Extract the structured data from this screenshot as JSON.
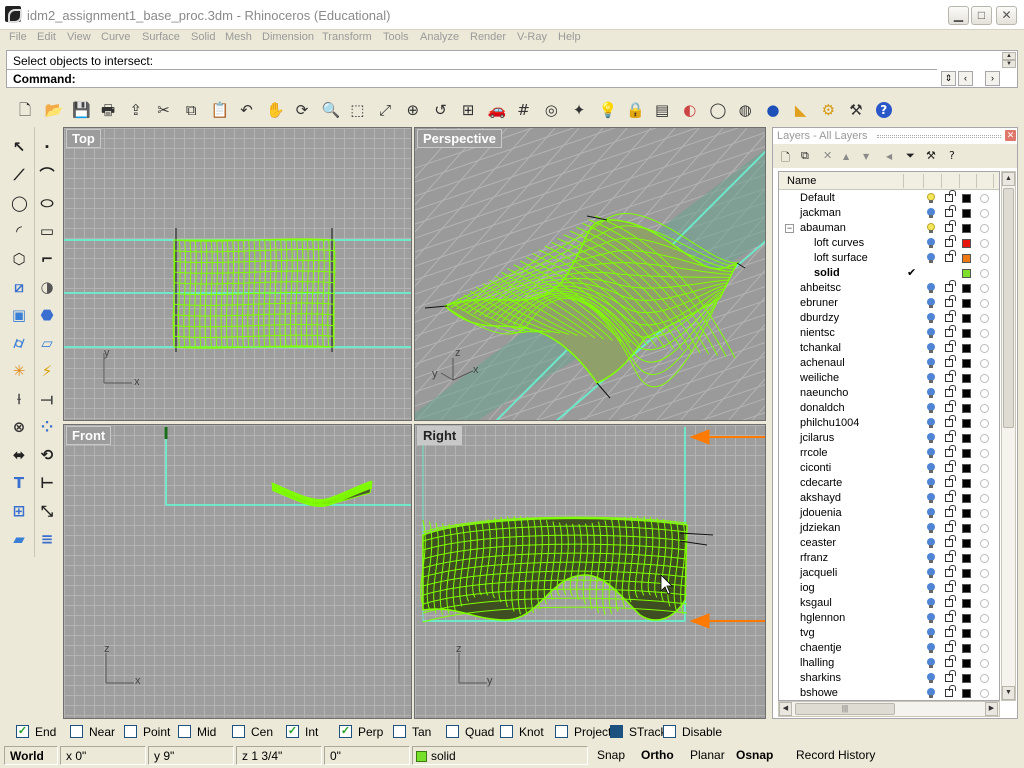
{
  "window": {
    "title": "idm2_assignment1_base_proc.3dm - Rhinoceros (Educational)",
    "minimize_icon": "minimize-icon",
    "maximize_icon": "maximize-icon",
    "close_icon": "close-icon"
  },
  "menu": [
    "File",
    "Edit",
    "View",
    "Curve",
    "Surface",
    "Solid",
    "Mesh",
    "Dimension",
    "Transform",
    "Tools",
    "Analyze",
    "Render",
    "V-Ray",
    "Help"
  ],
  "command": {
    "history": "Select objects to intersect:",
    "prompt": "Command:",
    "value": ""
  },
  "toolbar_icons": [
    "new-file-icon",
    "open-folder-icon",
    "save-icon",
    "print-icon",
    "import-icon",
    "cut-icon",
    "copy-icon",
    "paste-icon",
    "undo-icon",
    "pan-hand-icon",
    "rotate-view-icon",
    "zoom-dynamic-icon",
    "zoom-window-icon",
    "zoom-extents-icon",
    "zoom-selected-icon",
    "undo-view-icon",
    "four-viewports-icon",
    "car-icon",
    "grid-options-icon",
    "object-snap-icon",
    "point-edit-icon",
    "light-bulb-icon",
    "lock-icon",
    "layer-icon",
    "color-wheel-icon",
    "wireframe-sphere-icon",
    "shaded-sphere-icon",
    "render-sphere-icon",
    "render-spotlight-icon",
    "options-gear-icon",
    "settings-icon",
    "help-icon"
  ],
  "toolbox_icons": [
    "select-arrow-icon",
    "point-icon",
    "polyline-icon",
    "curve-icon",
    "circle-icon",
    "ellipse-icon",
    "arc-icon",
    "rectangle-icon",
    "polygon-icon",
    "fillet-icon",
    "surface-from-points-icon",
    "revolve-icon",
    "box-icon",
    "boolean-union-icon",
    "cylinder-icon",
    "mesh-plane-icon",
    "explode-icon",
    "trim-icon",
    "split-icon",
    "extend-icon",
    "group-icon",
    "array-icon",
    "move-icon",
    "rotate-icon",
    "text-icon",
    "dimension-icon",
    "array-grid-icon",
    "transform-icon",
    "solid-box-icon",
    "curtain-icon"
  ],
  "viewports": {
    "top": {
      "label": "Top",
      "axis_x": "x",
      "axis_y": "y"
    },
    "perspective": {
      "label": "Perspective",
      "axis_x": "x",
      "axis_y": "y",
      "axis_z": "z"
    },
    "front": {
      "label": "Front",
      "axis_x": "x",
      "axis_z": "z"
    },
    "right": {
      "label": "Right",
      "axis_y": "y",
      "axis_z": "z"
    }
  },
  "layers": {
    "title": "Layers - All Layers",
    "column_name": "Name",
    "toolbar_icons": [
      "new-layer-icon",
      "new-sublayer-icon",
      "delete-layer-icon",
      "move-up-icon",
      "move-down-icon",
      "move-left-icon",
      "filter-icon",
      "tools-icon",
      "help-icon"
    ],
    "items": [
      {
        "name": "Default",
        "indent": 0,
        "color": "#000000",
        "light": "on",
        "bold": false,
        "check": "",
        "toggle": ""
      },
      {
        "name": "jackman",
        "indent": 0,
        "color": "#000000",
        "light": "off",
        "bold": false,
        "check": "",
        "toggle": ""
      },
      {
        "name": "abauman",
        "indent": 0,
        "color": "#000000",
        "light": "on",
        "bold": false,
        "check": "",
        "toggle": "−"
      },
      {
        "name": "loft curves",
        "indent": 1,
        "color": "#e8150f",
        "light": "off",
        "bold": false,
        "check": "",
        "toggle": ""
      },
      {
        "name": "loft surface",
        "indent": 1,
        "color": "#f07a12",
        "light": "off",
        "bold": false,
        "check": "",
        "toggle": ""
      },
      {
        "name": "solid",
        "indent": 1,
        "color": "#7ddf2a",
        "light": "none",
        "bold": true,
        "check": "✔",
        "toggle": ""
      },
      {
        "name": "ahbeitsc",
        "indent": 0,
        "color": "#000000",
        "light": "off",
        "bold": false,
        "check": "",
        "toggle": ""
      },
      {
        "name": "ebruner",
        "indent": 0,
        "color": "#000000",
        "light": "off",
        "bold": false,
        "check": "",
        "toggle": ""
      },
      {
        "name": "dburdzy",
        "indent": 0,
        "color": "#000000",
        "light": "off",
        "bold": false,
        "check": "",
        "toggle": ""
      },
      {
        "name": "nientsc",
        "indent": 0,
        "color": "#000000",
        "light": "off",
        "bold": false,
        "check": "",
        "toggle": ""
      },
      {
        "name": "tchankal",
        "indent": 0,
        "color": "#000000",
        "light": "off",
        "bold": false,
        "check": "",
        "toggle": ""
      },
      {
        "name": "achenaul",
        "indent": 0,
        "color": "#000000",
        "light": "off",
        "bold": false,
        "check": "",
        "toggle": ""
      },
      {
        "name": "weiliche",
        "indent": 0,
        "color": "#000000",
        "light": "off",
        "bold": false,
        "check": "",
        "toggle": ""
      },
      {
        "name": "naeuncho",
        "indent": 0,
        "color": "#000000",
        "light": "off",
        "bold": false,
        "check": "",
        "toggle": ""
      },
      {
        "name": "donaldch",
        "indent": 0,
        "color": "#000000",
        "light": "off",
        "bold": false,
        "check": "",
        "toggle": ""
      },
      {
        "name": "philchu1004",
        "indent": 0,
        "color": "#000000",
        "light": "off",
        "bold": false,
        "check": "",
        "toggle": ""
      },
      {
        "name": "jcilarus",
        "indent": 0,
        "color": "#000000",
        "light": "off",
        "bold": false,
        "check": "",
        "toggle": ""
      },
      {
        "name": "rrcole",
        "indent": 0,
        "color": "#000000",
        "light": "off",
        "bold": false,
        "check": "",
        "toggle": ""
      },
      {
        "name": "ciconti",
        "indent": 0,
        "color": "#000000",
        "light": "off",
        "bold": false,
        "check": "",
        "toggle": ""
      },
      {
        "name": "cdecarte",
        "indent": 0,
        "color": "#000000",
        "light": "off",
        "bold": false,
        "check": "",
        "toggle": ""
      },
      {
        "name": "akshayd",
        "indent": 0,
        "color": "#000000",
        "light": "off",
        "bold": false,
        "check": "",
        "toggle": ""
      },
      {
        "name": "jdouenia",
        "indent": 0,
        "color": "#000000",
        "light": "off",
        "bold": false,
        "check": "",
        "toggle": ""
      },
      {
        "name": "jdziekan",
        "indent": 0,
        "color": "#000000",
        "light": "off",
        "bold": false,
        "check": "",
        "toggle": ""
      },
      {
        "name": "ceaster",
        "indent": 0,
        "color": "#000000",
        "light": "off",
        "bold": false,
        "check": "",
        "toggle": ""
      },
      {
        "name": "rfranz",
        "indent": 0,
        "color": "#000000",
        "light": "off",
        "bold": false,
        "check": "",
        "toggle": ""
      },
      {
        "name": "jacqueli",
        "indent": 0,
        "color": "#000000",
        "light": "off",
        "bold": false,
        "check": "",
        "toggle": ""
      },
      {
        "name": "iog",
        "indent": 0,
        "color": "#000000",
        "light": "off",
        "bold": false,
        "check": "",
        "toggle": ""
      },
      {
        "name": "ksgaul",
        "indent": 0,
        "color": "#000000",
        "light": "off",
        "bold": false,
        "check": "",
        "toggle": ""
      },
      {
        "name": "hglennon",
        "indent": 0,
        "color": "#000000",
        "light": "off",
        "bold": false,
        "check": "",
        "toggle": ""
      },
      {
        "name": "tvg",
        "indent": 0,
        "color": "#000000",
        "light": "off",
        "bold": false,
        "check": "",
        "toggle": ""
      },
      {
        "name": "chaentje",
        "indent": 0,
        "color": "#000000",
        "light": "off",
        "bold": false,
        "check": "",
        "toggle": ""
      },
      {
        "name": "lhalling",
        "indent": 0,
        "color": "#000000",
        "light": "off",
        "bold": false,
        "check": "",
        "toggle": ""
      },
      {
        "name": "sharkins",
        "indent": 0,
        "color": "#000000",
        "light": "off",
        "bold": false,
        "check": "",
        "toggle": ""
      },
      {
        "name": "bshowe",
        "indent": 0,
        "color": "#000000",
        "light": "off",
        "bold": false,
        "check": "",
        "toggle": ""
      }
    ]
  },
  "osnaps": [
    {
      "label": "End",
      "checked": true
    },
    {
      "label": "Near",
      "checked": false
    },
    {
      "label": "Point",
      "checked": false
    },
    {
      "label": "Mid",
      "checked": false
    },
    {
      "label": "Cen",
      "checked": false
    },
    {
      "label": "Int",
      "checked": true
    },
    {
      "label": "Perp",
      "checked": true
    },
    {
      "label": "Tan",
      "checked": false
    },
    {
      "label": "Quad",
      "checked": false
    },
    {
      "label": "Knot",
      "checked": false
    },
    {
      "label": "Project",
      "checked": false
    },
    {
      "label": "STrack",
      "checked": "filled"
    },
    {
      "label": "Disable",
      "checked": false
    }
  ],
  "status": {
    "cplane": "World",
    "x": "x 0\"",
    "y": "y 9\"",
    "z": "z 1 3/4\"",
    "dist": "0\"",
    "layer": "solid",
    "layer_color": "#76e02a",
    "snap": "Snap",
    "ortho": "Ortho",
    "planar": "Planar",
    "osnap": "Osnap",
    "record_history": "Record History"
  },
  "colors": {
    "surface_green": "#80ff00",
    "selection_cyan": "#6ee8c8",
    "arrow_orange": "#ff7a00"
  }
}
